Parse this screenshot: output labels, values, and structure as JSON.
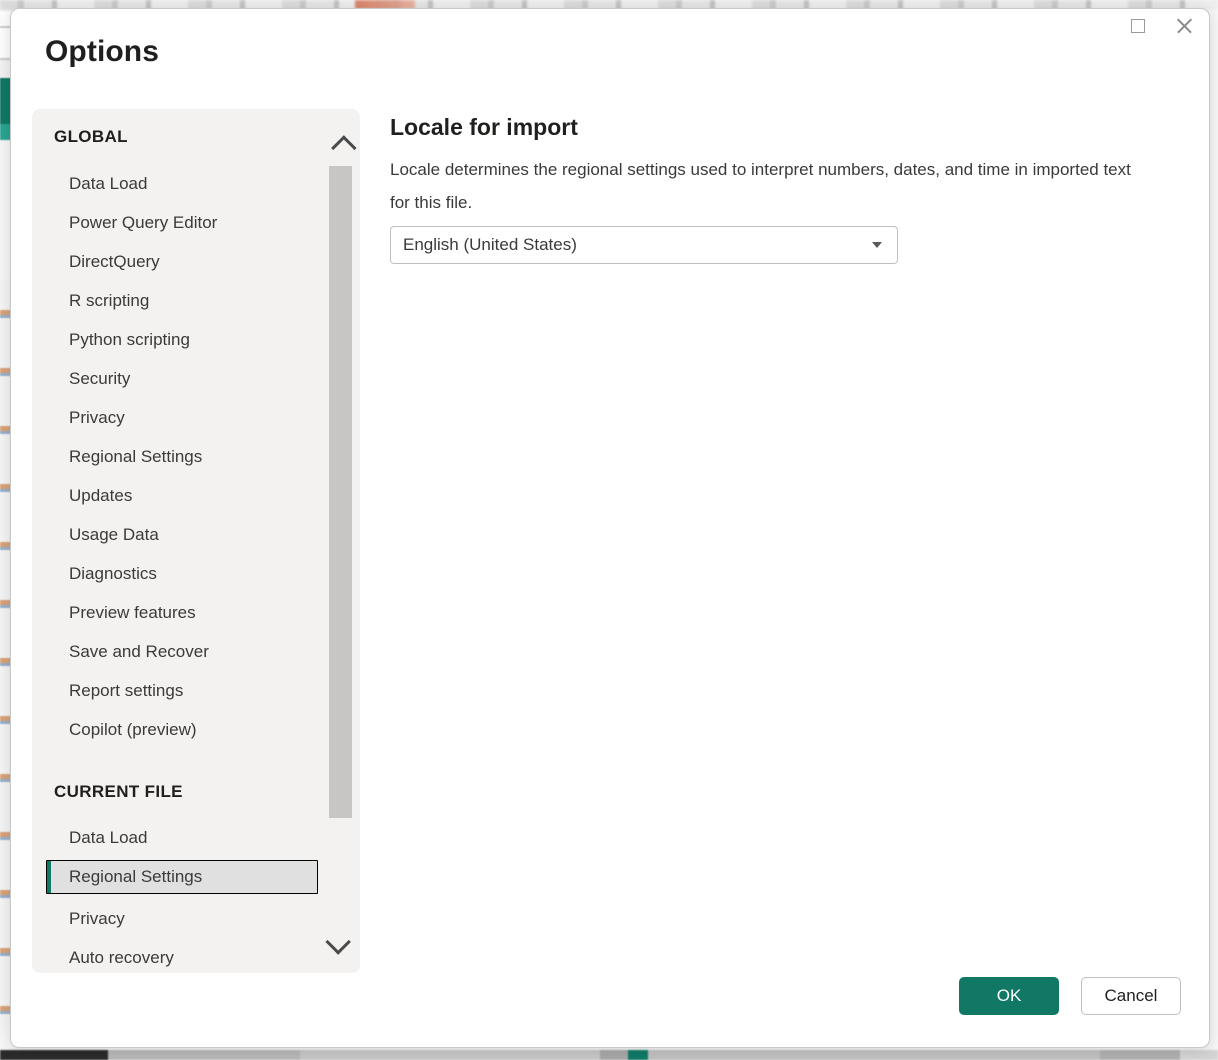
{
  "dialog": {
    "title": "Options",
    "window_controls": [
      {
        "name": "maximize",
        "icon": "maximize-icon"
      },
      {
        "name": "close",
        "icon": "close-icon"
      }
    ]
  },
  "sidebar": {
    "groups": [
      {
        "heading": "GLOBAL",
        "items": [
          {
            "label": "Data Load",
            "selected": false
          },
          {
            "label": "Power Query Editor",
            "selected": false
          },
          {
            "label": "DirectQuery",
            "selected": false
          },
          {
            "label": "R scripting",
            "selected": false
          },
          {
            "label": "Python scripting",
            "selected": false
          },
          {
            "label": "Security",
            "selected": false
          },
          {
            "label": "Privacy",
            "selected": false
          },
          {
            "label": "Regional Settings",
            "selected": false
          },
          {
            "label": "Updates",
            "selected": false
          },
          {
            "label": "Usage Data",
            "selected": false
          },
          {
            "label": "Diagnostics",
            "selected": false
          },
          {
            "label": "Preview features",
            "selected": false
          },
          {
            "label": "Save and Recover",
            "selected": false
          },
          {
            "label": "Report settings",
            "selected": false
          },
          {
            "label": "Copilot (preview)",
            "selected": false
          }
        ]
      },
      {
        "heading": "CURRENT FILE",
        "items": [
          {
            "label": "Data Load",
            "selected": false
          },
          {
            "label": "Regional Settings",
            "selected": true
          },
          {
            "label": "Privacy",
            "selected": false
          },
          {
            "label": "Auto recovery",
            "selected": false
          }
        ]
      }
    ],
    "scrollbar": {
      "up_arrow_icon": "chevron-up-icon",
      "down_arrow_icon": "chevron-down-icon"
    }
  },
  "main": {
    "heading": "Locale for import",
    "description": "Locale determines the regional settings used to interpret numbers, dates, and time in imported text for this file.",
    "locale_select": {
      "value": "English (United States)",
      "caret_icon": "chevron-down-icon"
    }
  },
  "footer": {
    "ok_label": "OK",
    "cancel_label": "Cancel"
  },
  "colors": {
    "accent": "#117865",
    "sidebar_bg": "#f3f2f1",
    "selected_bg": "#e0e0e0",
    "scrollbar_thumb": "#c8c6c4",
    "text": "#201f1e"
  }
}
